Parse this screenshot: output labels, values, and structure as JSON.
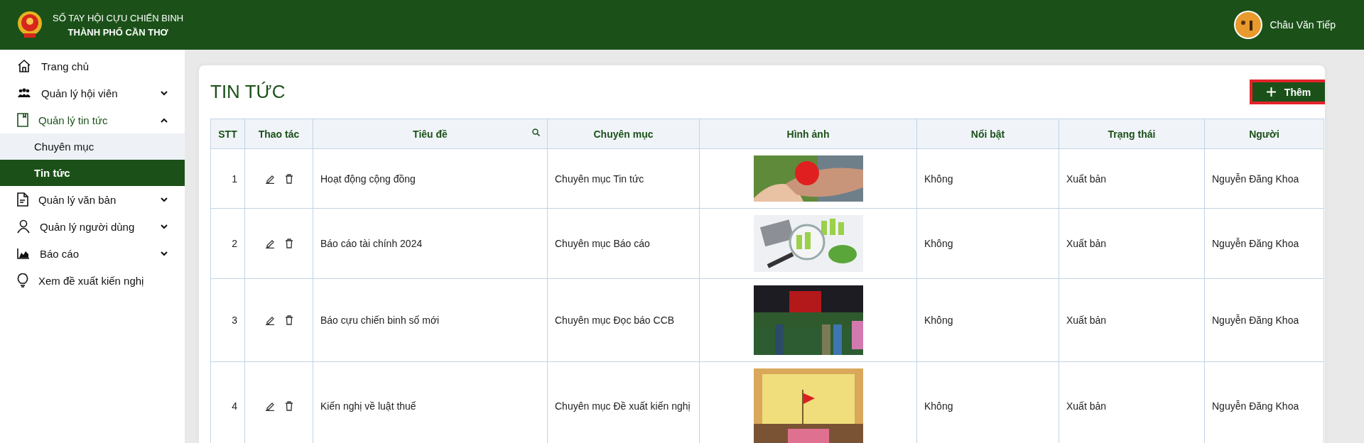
{
  "header": {
    "title_line1": "SỐ TAY HỘI CỰU CHIẾN BINH",
    "title_line2": "THÀNH PHỐ CẦN THƠ",
    "user_name": "Châu Văn Tiếp"
  },
  "sidebar": {
    "items": [
      {
        "kind": "link",
        "label": "Trang chủ"
      },
      {
        "kind": "group",
        "label": "Quản lý hội viên",
        "expanded": false
      },
      {
        "kind": "group",
        "label": "Quản lý tin tức",
        "expanded": true,
        "children": [
          {
            "label": "Chuyên mục",
            "selected": false
          },
          {
            "label": "Tin tức",
            "selected": true
          }
        ]
      },
      {
        "kind": "group",
        "label": "Quản lý văn bản",
        "expanded": false
      },
      {
        "kind": "group",
        "label": "Quản lý người dùng",
        "expanded": false
      },
      {
        "kind": "group",
        "label": "Báo cáo",
        "expanded": false
      },
      {
        "kind": "link",
        "label": "Xem đề xuất kiến nghị"
      }
    ]
  },
  "page": {
    "title": "TIN TỨC",
    "add_button": {
      "label": "Thêm",
      "highlighted": true
    }
  },
  "table": {
    "columns": [
      {
        "label": "STT",
        "searchable": false
      },
      {
        "label": "Thao tác",
        "searchable": false
      },
      {
        "label": "Tiêu đề",
        "searchable": true
      },
      {
        "label": "Chuyên mục",
        "searchable": false
      },
      {
        "label": "Hình ảnh",
        "searchable": false
      },
      {
        "label": "Nổi bật",
        "searchable": false
      },
      {
        "label": "Trạng thái",
        "searchable": false
      },
      {
        "label": "Người",
        "searchable": false
      }
    ],
    "rows": [
      {
        "stt": "1",
        "title": "Hoạt động cộng đồng",
        "category": "Chuyên mục Tin tức",
        "featured": "Không",
        "status": "Xuất bản",
        "author": "Nguyễn Đăng Khoa"
      },
      {
        "stt": "2",
        "title": "Báo cáo tài chính 2024",
        "category": "Chuyên mục Báo cáo",
        "featured": "Không",
        "status": "Xuất bản",
        "author": "Nguyễn Đăng Khoa"
      },
      {
        "stt": "3",
        "title": "Báo cựu chiến binh số mới",
        "category": "Chuyên mục Đọc báo CCB",
        "featured": "Không",
        "status": "Xuất bản",
        "author": "Nguyễn Đăng Khoa"
      },
      {
        "stt": "4",
        "title": "Kiến nghị về luật thuế",
        "category": "Chuyên mục Đề xuất kiến nghị",
        "featured": "Không",
        "status": "Xuất bản",
        "author": "Nguyễn Đăng Khoa"
      }
    ]
  }
}
